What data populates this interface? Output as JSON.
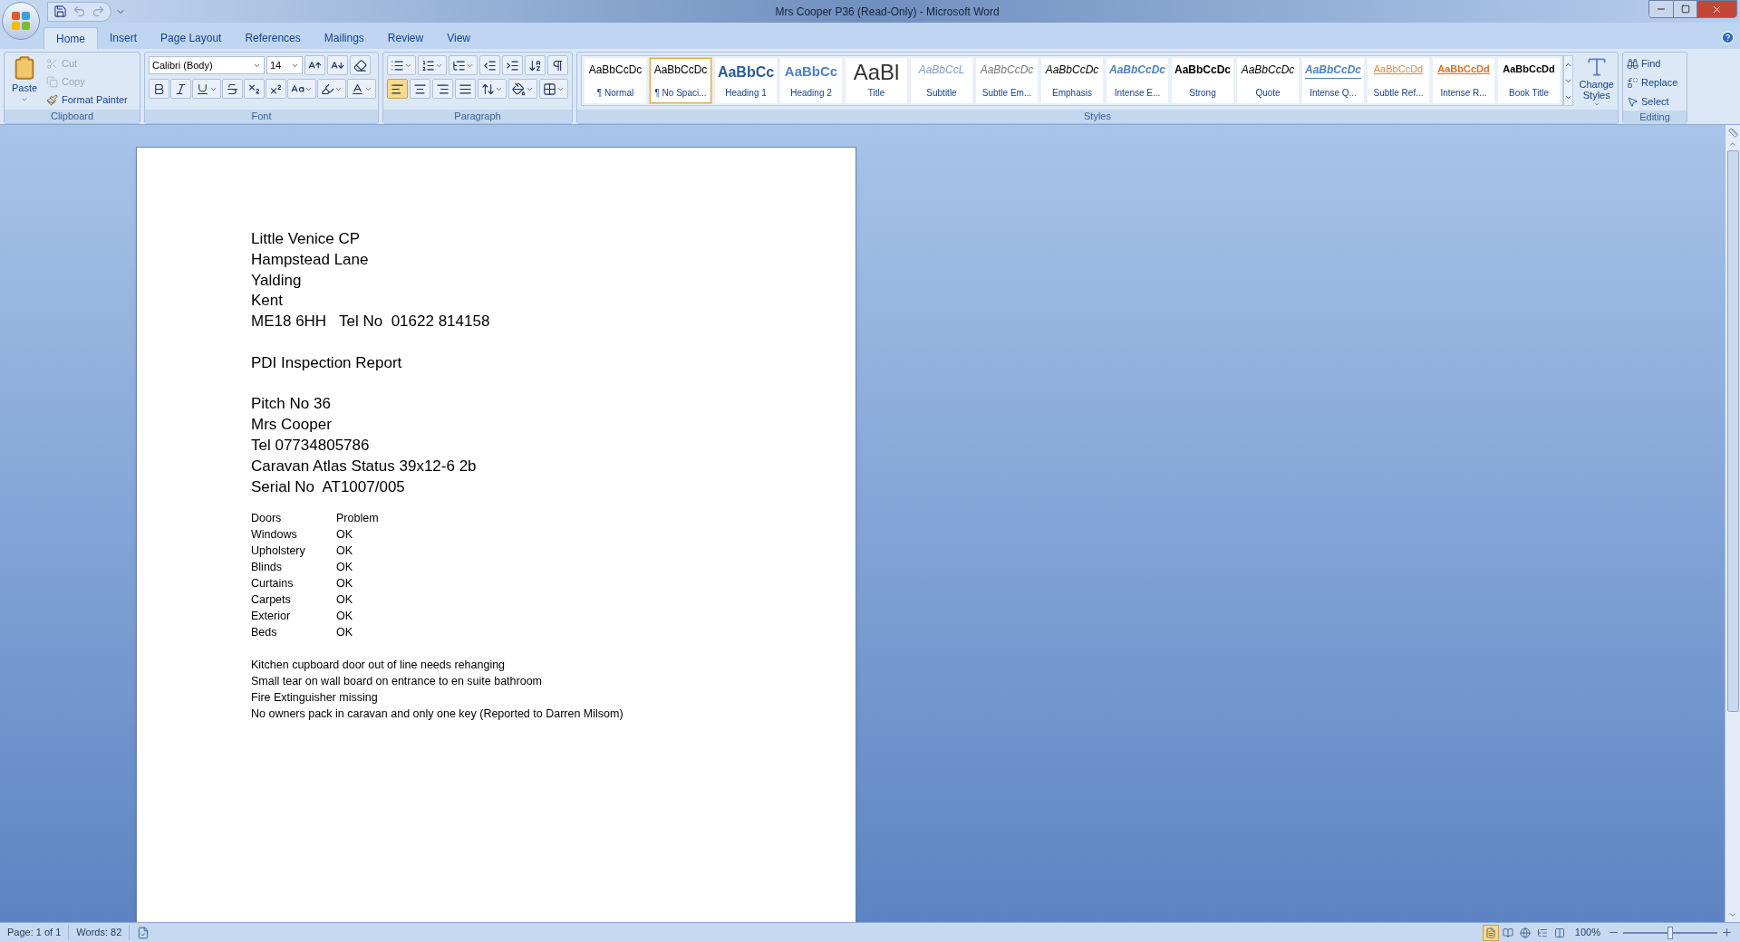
{
  "window": {
    "title": "Mrs Cooper P36 (Read-Only) - Microsoft Word"
  },
  "tabs": [
    {
      "label": "Home",
      "selected": true
    },
    {
      "label": "Insert",
      "selected": false
    },
    {
      "label": "Page Layout",
      "selected": false
    },
    {
      "label": "References",
      "selected": false
    },
    {
      "label": "Mailings",
      "selected": false
    },
    {
      "label": "Review",
      "selected": false
    },
    {
      "label": "View",
      "selected": false
    }
  ],
  "clipboard": {
    "label": "Clipboard",
    "paste": "Paste",
    "items": [
      {
        "kind": "cut",
        "label": "Cut",
        "disabled": true
      },
      {
        "kind": "copy",
        "label": "Copy",
        "disabled": true
      },
      {
        "kind": "painter",
        "label": "Format Painter",
        "disabled": false
      }
    ]
  },
  "font": {
    "label": "Font",
    "name": "Calibri (Body)",
    "size": "14"
  },
  "paragraph": {
    "label": "Paragraph",
    "alignments": [
      {
        "kind": "left",
        "selected": true
      },
      {
        "kind": "center",
        "selected": false
      },
      {
        "kind": "right",
        "selected": false
      },
      {
        "kind": "justify",
        "selected": false
      }
    ]
  },
  "styles": {
    "label": "Styles",
    "change": "Change Styles",
    "items": [
      {
        "kind": "normal",
        "preview": "AaBbCcDc",
        "name": "¶ Normal",
        "selected": false
      },
      {
        "kind": "normal",
        "preview": "AaBbCcDc",
        "name": "¶ No Spaci...",
        "selected": true
      },
      {
        "kind": "heading1",
        "preview": "AaBbCc",
        "name": "Heading 1",
        "selected": false
      },
      {
        "kind": "heading2",
        "preview": "AaBbCc",
        "name": "Heading 2",
        "selected": false
      },
      {
        "kind": "title",
        "preview": "AaBl",
        "name": "Title",
        "selected": false
      },
      {
        "kind": "subtitle",
        "preview": "AaBbCcL",
        "name": "Subtitle",
        "selected": false
      },
      {
        "kind": "subtle",
        "preview": "AaBbCcDc",
        "name": "Subtle Em...",
        "selected": false
      },
      {
        "kind": "emphasis",
        "preview": "AaBbCcDc",
        "name": "Emphasis",
        "selected": false
      },
      {
        "kind": "intense",
        "preview": "AaBbCcDc",
        "name": "Intense E...",
        "selected": false
      },
      {
        "kind": "strong",
        "preview": "AaBbCcDc",
        "name": "Strong",
        "selected": false
      },
      {
        "kind": "emphasis",
        "preview": "AaBbCcDc",
        "name": "Quote",
        "selected": false
      },
      {
        "kind": "intensequote",
        "preview": "AaBbCcDc",
        "name": "Intense Q...",
        "selected": false
      },
      {
        "kind": "subtleref",
        "preview": "AaBbCcDd",
        "name": "Subtle Ref...",
        "selected": false
      },
      {
        "kind": "intenseref",
        "preview": "AaBbCcDd",
        "name": "Intense R...",
        "selected": false
      },
      {
        "kind": "booktitle",
        "preview": "AaBbCcDd",
        "name": "Book Title",
        "selected": false
      }
    ]
  },
  "editing": {
    "label": "Editing",
    "items": [
      {
        "kind": "find",
        "label": "Find"
      },
      {
        "kind": "replace",
        "label": "Replace"
      },
      {
        "kind": "select",
        "label": "Select"
      }
    ]
  },
  "document": {
    "address_lines": [
      "Little Venice CP",
      "Hampstead Lane",
      "Yalding",
      "Kent",
      "ME18 6HH   Tel No  01622 814158"
    ],
    "report_title": "PDI Inspection Report",
    "details": [
      "Pitch No 36",
      "Mrs Cooper",
      "Tel 07734805786",
      "Caravan Atlas Status 39x12-6 2b",
      "Serial No  AT1007/005"
    ],
    "checklist": [
      {
        "item": "Doors",
        "status": "Problem"
      },
      {
        "item": "Windows",
        "status": "OK"
      },
      {
        "item": "Upholstery",
        "status": "OK"
      },
      {
        "item": "Blinds",
        "status": "OK"
      },
      {
        "item": "Curtains",
        "status": "OK"
      },
      {
        "item": "Carpets",
        "status": "OK"
      },
      {
        "item": "Exterior",
        "status": "OK"
      },
      {
        "item": "Beds",
        "status": "OK"
      }
    ],
    "notes": [
      "Kitchen cupboard door out of line needs rehanging",
      "Small tear on wall board on entrance to en suite bathroom",
      "Fire Extinguisher missing",
      "No owners pack in caravan and only one key (Reported to Darren Milsom)"
    ]
  },
  "status_bar": {
    "page": "Page: 1 of 1",
    "words": "Words: 82",
    "views": [
      {
        "selected": true
      },
      {
        "selected": false
      },
      {
        "selected": false
      },
      {
        "selected": false
      },
      {
        "selected": false
      }
    ],
    "zoom": "100%",
    "zoom_level": {
      "level": 0.5
    }
  }
}
